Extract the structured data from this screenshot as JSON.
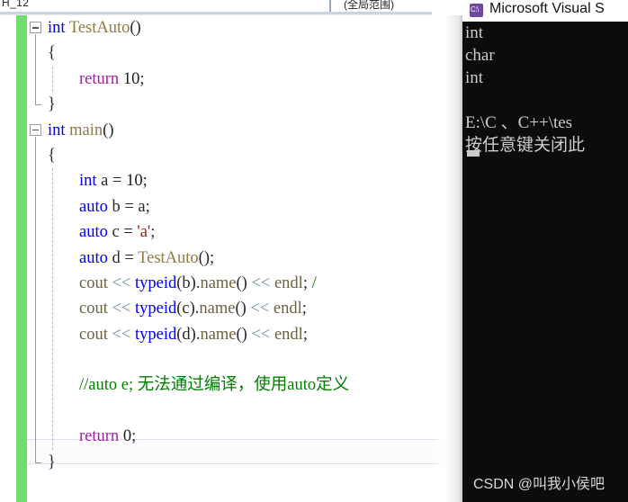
{
  "ide": {
    "nav_bar": {
      "left_dropdown": "H_12",
      "right_dropdown": "(全局范围)"
    },
    "change_bar_color": "#6fdc6f",
    "colors": {
      "keyword": "#0000ff",
      "function": "#8b7b45",
      "string": "#a31515",
      "comment": "#008000",
      "return_keyword": "#a020a0",
      "operator": "#6f8f9f",
      "background": "#ffffff"
    },
    "code_lines": [
      {
        "fold": "minus",
        "indent": 0,
        "tokens": [
          {
            "t": "int",
            "c": "kw"
          },
          {
            "t": " ",
            "c": "punct"
          },
          {
            "t": "TestAuto",
            "c": "fn"
          },
          {
            "t": "()",
            "c": "punct"
          }
        ]
      },
      {
        "fold": "",
        "indent": 1,
        "tokens": [
          {
            "t": "{",
            "c": "punct"
          }
        ]
      },
      {
        "fold": "",
        "indent": 2,
        "tokens": [
          {
            "t": "return",
            "c": "ret"
          },
          {
            "t": " ",
            "c": "punct"
          },
          {
            "t": "10",
            "c": "num"
          },
          {
            "t": ";",
            "c": "punct"
          }
        ]
      },
      {
        "fold": "",
        "indent": 1,
        "tokens": [
          {
            "t": "}",
            "c": "punct"
          }
        ]
      },
      {
        "fold": "minus",
        "indent": 0,
        "tokens": [
          {
            "t": "int",
            "c": "kw"
          },
          {
            "t": " ",
            "c": "punct"
          },
          {
            "t": "main",
            "c": "fn"
          },
          {
            "t": "()",
            "c": "punct"
          }
        ]
      },
      {
        "fold": "",
        "indent": 1,
        "tokens": [
          {
            "t": "{",
            "c": "punct"
          }
        ]
      },
      {
        "fold": "",
        "indent": 2,
        "tokens": [
          {
            "t": "int",
            "c": "kw"
          },
          {
            "t": " a = ",
            "c": "id"
          },
          {
            "t": "10",
            "c": "num"
          },
          {
            "t": ";",
            "c": "punct"
          }
        ]
      },
      {
        "fold": "",
        "indent": 2,
        "tokens": [
          {
            "t": "auto",
            "c": "kw"
          },
          {
            "t": " b = a;",
            "c": "id"
          }
        ]
      },
      {
        "fold": "",
        "indent": 2,
        "tokens": [
          {
            "t": "auto",
            "c": "kw"
          },
          {
            "t": " c = ",
            "c": "id"
          },
          {
            "t": "'a'",
            "c": "str"
          },
          {
            "t": ";",
            "c": "punct"
          }
        ]
      },
      {
        "fold": "",
        "indent": 2,
        "tokens": [
          {
            "t": "auto",
            "c": "kw"
          },
          {
            "t": " d = ",
            "c": "id"
          },
          {
            "t": "TestAuto",
            "c": "fn"
          },
          {
            "t": "();",
            "c": "punct"
          }
        ]
      },
      {
        "fold": "",
        "indent": 2,
        "tokens": [
          {
            "t": "cout",
            "c": "obj"
          },
          {
            "t": " ",
            "c": "punct"
          },
          {
            "t": "<<",
            "c": "op"
          },
          {
            "t": " ",
            "c": "punct"
          },
          {
            "t": "typeid",
            "c": "kw"
          },
          {
            "t": "(b)",
            "c": "punct"
          },
          {
            "t": ".",
            "c": "punct"
          },
          {
            "t": "name",
            "c": "obj"
          },
          {
            "t": "()",
            "c": "punct"
          },
          {
            "t": " ",
            "c": "punct"
          },
          {
            "t": "<<",
            "c": "op"
          },
          {
            "t": " ",
            "c": "punct"
          },
          {
            "t": "endl",
            "c": "obj"
          },
          {
            "t": ";",
            "c": "punct"
          },
          {
            "t": " /",
            "c": "cmt"
          }
        ]
      },
      {
        "fold": "",
        "indent": 2,
        "tokens": [
          {
            "t": "cout",
            "c": "obj"
          },
          {
            "t": " ",
            "c": "punct"
          },
          {
            "t": "<<",
            "c": "op"
          },
          {
            "t": " ",
            "c": "punct"
          },
          {
            "t": "typeid",
            "c": "kw"
          },
          {
            "t": "(c)",
            "c": "punct"
          },
          {
            "t": ".",
            "c": "punct"
          },
          {
            "t": "name",
            "c": "obj"
          },
          {
            "t": "()",
            "c": "punct"
          },
          {
            "t": " ",
            "c": "punct"
          },
          {
            "t": "<<",
            "c": "op"
          },
          {
            "t": " ",
            "c": "punct"
          },
          {
            "t": "endl",
            "c": "obj"
          },
          {
            "t": ";",
            "c": "punct"
          }
        ]
      },
      {
        "fold": "",
        "indent": 2,
        "tokens": [
          {
            "t": "cout",
            "c": "obj"
          },
          {
            "t": " ",
            "c": "punct"
          },
          {
            "t": "<<",
            "c": "op"
          },
          {
            "t": " ",
            "c": "punct"
          },
          {
            "t": "typeid",
            "c": "kw"
          },
          {
            "t": "(d)",
            "c": "punct"
          },
          {
            "t": ".",
            "c": "punct"
          },
          {
            "t": "name",
            "c": "obj"
          },
          {
            "t": "()",
            "c": "punct"
          },
          {
            "t": " ",
            "c": "punct"
          },
          {
            "t": "<<",
            "c": "op"
          },
          {
            "t": " ",
            "c": "punct"
          },
          {
            "t": "endl",
            "c": "obj"
          },
          {
            "t": ";",
            "c": "punct"
          }
        ]
      },
      {
        "fold": "",
        "indent": 2,
        "tokens": []
      },
      {
        "fold": "",
        "indent": 2,
        "tokens": [
          {
            "t": "//auto e; 无法通过编译，使用auto定义",
            "c": "cmt"
          }
        ]
      },
      {
        "fold": "",
        "indent": 2,
        "tokens": []
      },
      {
        "fold": "",
        "indent": 2,
        "current": true,
        "tokens": [
          {
            "t": "return",
            "c": "ret"
          },
          {
            "t": " ",
            "c": "punct"
          },
          {
            "t": "0",
            "c": "num"
          },
          {
            "t": ";",
            "c": "punct"
          }
        ]
      },
      {
        "fold": "",
        "indent": 1,
        "tokens": [
          {
            "t": "}",
            "c": "punct"
          }
        ]
      }
    ]
  },
  "console": {
    "title": "Microsoft Visual S",
    "icon_label": "C:\\",
    "output_lines": [
      "int",
      "char",
      "int",
      "",
      "E:\\C 、C++\\tes",
      "按任意键关闭此"
    ],
    "watermark": "CSDN @叫我小侯吧"
  }
}
